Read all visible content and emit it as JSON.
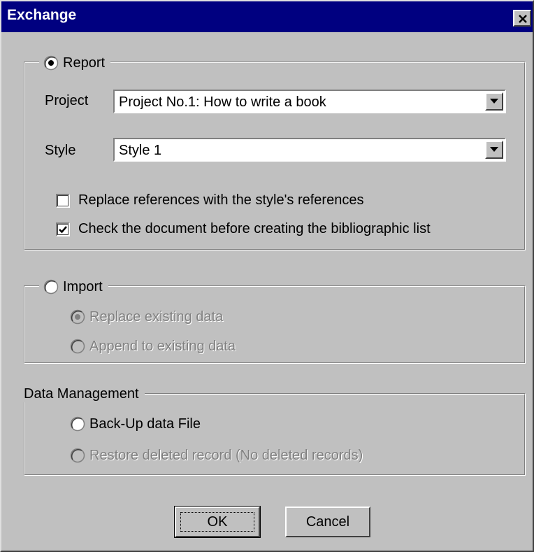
{
  "dialog": {
    "title": "Exchange",
    "close_icon": "close-icon"
  },
  "report": {
    "label": "Report",
    "selected": true,
    "project_label": "Project",
    "project_value": "Project No.1: How to write a book",
    "style_label": "Style",
    "style_value": "Style 1",
    "replace_refs_label": "Replace references with the style's references",
    "replace_refs_checked": false,
    "check_doc_label": "Check the document before creating the bibliographic list",
    "check_doc_checked": true
  },
  "import": {
    "label": "Import",
    "selected": false,
    "replace_label": "Replace existing data",
    "replace_selected": true,
    "append_label": "Append to existing data",
    "append_selected": false
  },
  "data_management": {
    "label": "Data Management",
    "backup_label": "Back-Up data File",
    "restore_label": "Restore deleted record (No deleted records)"
  },
  "buttons": {
    "ok_label": "OK",
    "cancel_label": "Cancel"
  }
}
